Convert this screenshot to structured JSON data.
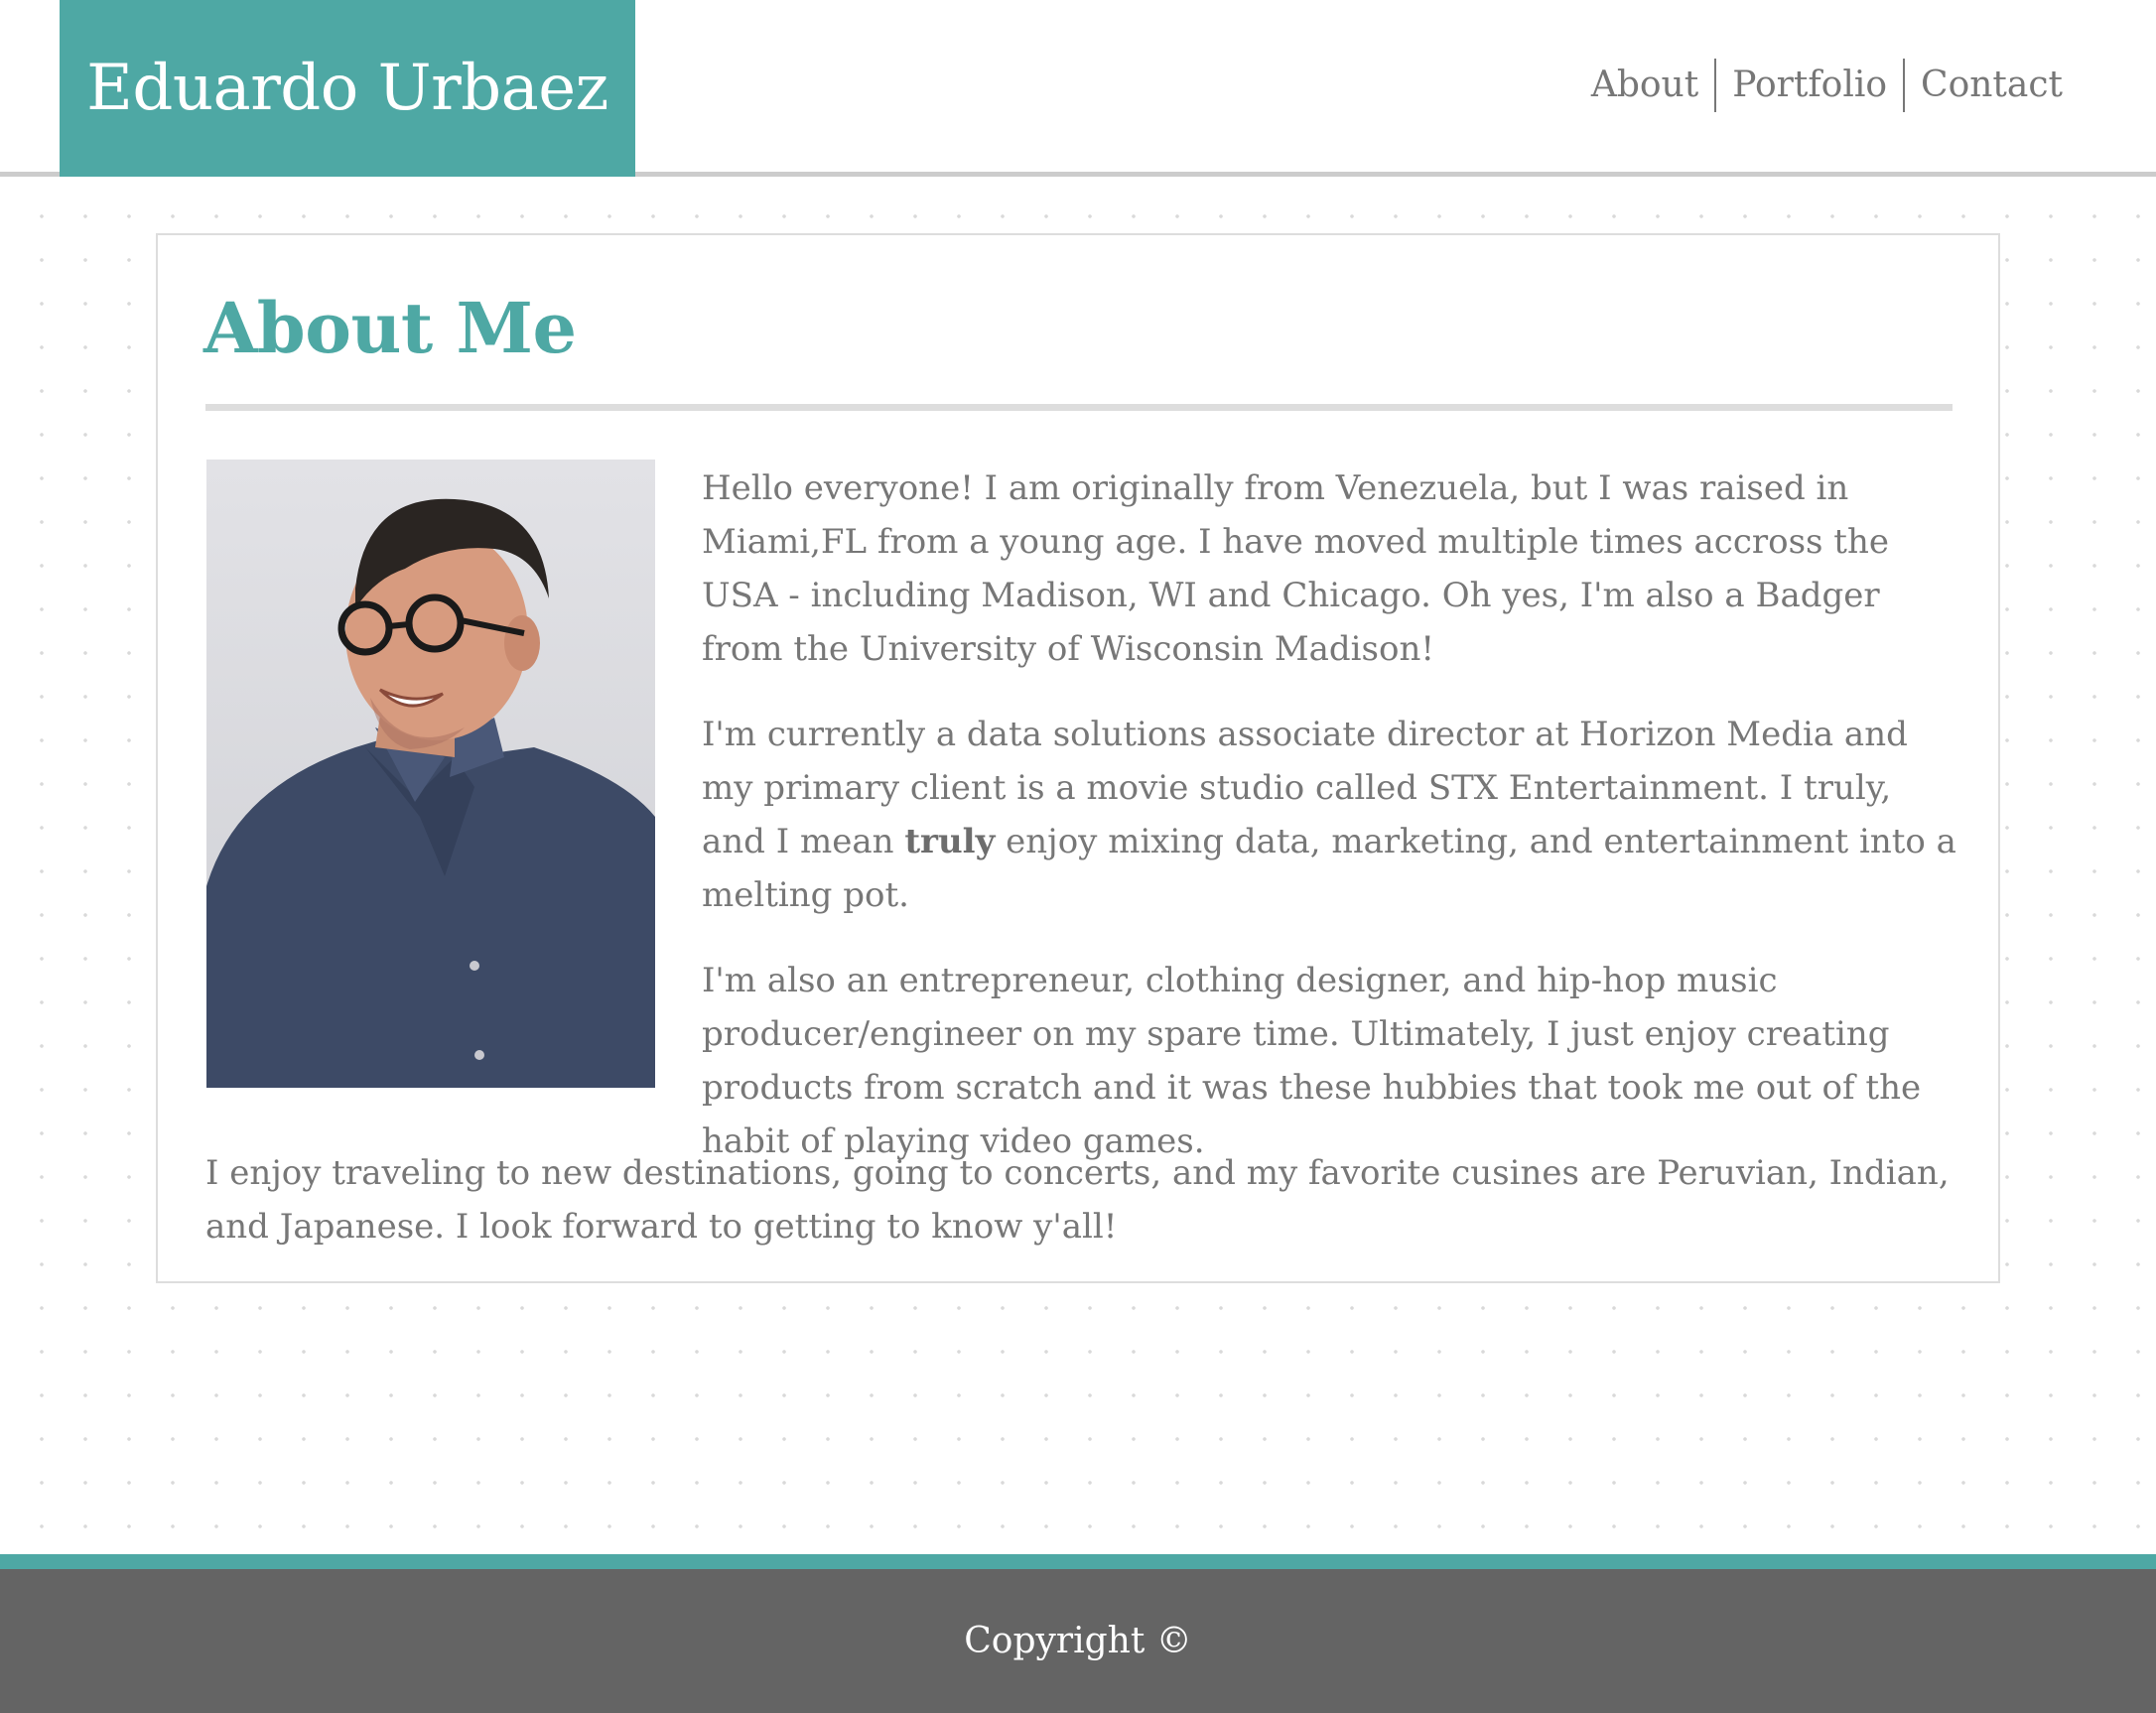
{
  "header": {
    "brand": "Eduardo Urbaez",
    "nav": [
      "About",
      "Portfolio",
      "Contact"
    ]
  },
  "about": {
    "title": "About Me",
    "para1": "Hello everyone! I am originally from Venezuela, but I was raised in Miami,FL from a young age. I have moved multiple times accross the USA - including Madison, WI and Chicago. Oh yes, I'm also a Badger from the University of Wisconsin Madison!",
    "para2_before": "I'm currently a data solutions associate director at Horizon Media and my primary client is a movie studio called STX Entertainment. I truly, and I mean ",
    "para2_bold": "truly",
    "para2_after": " enjoy mixing data, marketing, and entertainment into a melting pot.",
    "para3": "I'm also an entrepreneur, clothing designer, and hip-hop music producer/engineer on my spare time. Ultimately, I just enjoy creating products from scratch and it was these hubbies that took me out of the habit of playing video games.",
    "para4": "I enjoy traveling to new destinations, going to concerts, and my favorite cusines are Peruvian, Indian, and Japanese. I look forward to getting to know y'all!"
  },
  "footer": {
    "copyright": "Copyright ©"
  },
  "colors": {
    "accent": "#4ea8a4",
    "footer": "#646464",
    "text": "#777777"
  }
}
